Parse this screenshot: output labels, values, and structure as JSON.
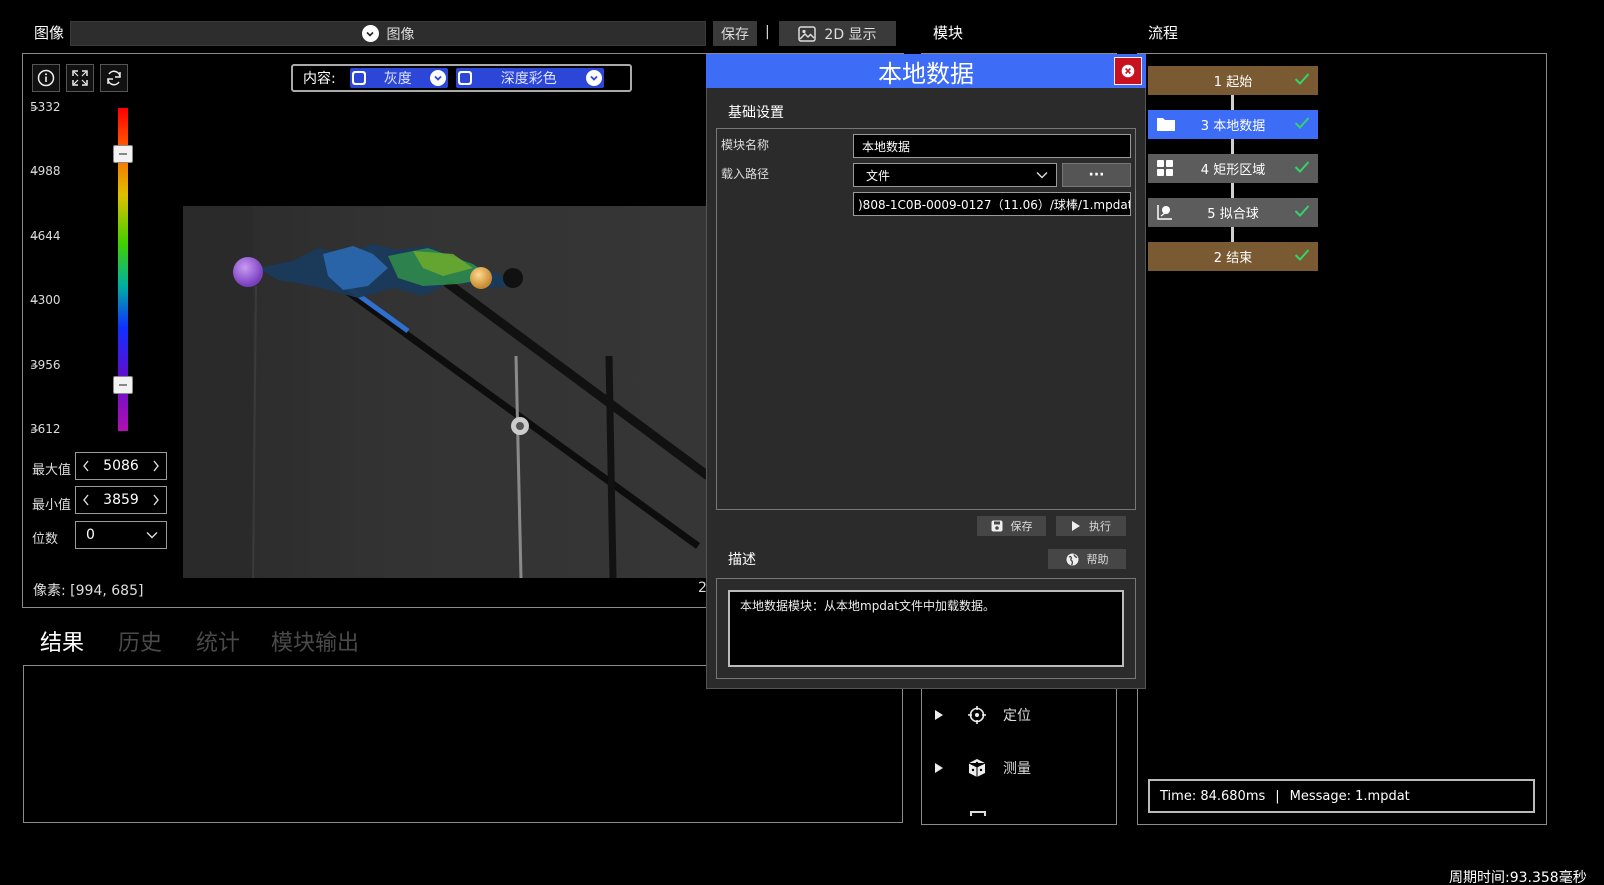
{
  "top": {
    "image_label": "图像",
    "image_combo": "图像",
    "save_label": "保存",
    "separator": "|",
    "display_label": "2D 显示",
    "module_label": "模块",
    "flow_label": "流程"
  },
  "viewer": {
    "content_label": "内容:",
    "gray_label": "灰度",
    "depth_label": "深度彩色",
    "scale_ticks": [
      "5332",
      "4988",
      "4644",
      "4300",
      "3956",
      "3612"
    ],
    "max_label": "最大值",
    "max_value": "5086",
    "min_label": "最小值",
    "min_value": "3859",
    "digits_label": "位数",
    "digits_value": "0",
    "pixel_text": "像素: [994, 685]",
    "clipped_text": "2"
  },
  "results": {
    "tabs": [
      "结果",
      "历史",
      "统计",
      "模块输出"
    ]
  },
  "dialog": {
    "title": "本地数据",
    "section_basic": "基础设置",
    "module_name_label": "模块名称",
    "module_name_value": "本地数据",
    "load_path_label": "载入路径",
    "load_type": "文件",
    "browse_label": "···",
    "path_value": ")808-1C0B-0009-0127（11.06）/球棒/1.mpdat",
    "save_label": "保存",
    "run_label": "执行",
    "desc_label": "描述",
    "help_label": "帮助",
    "desc_text": "本地数据模块：从本地mpdat文件中加载数据。"
  },
  "modules": {
    "items": [
      "定位",
      "测量"
    ]
  },
  "flow": {
    "items": [
      {
        "label": "1 起始",
        "color": "#7a5a32"
      },
      {
        "label": "3 本地数据",
        "color": "#3d6cf7"
      },
      {
        "label": "4 矩形区域",
        "color": "#5c5c5c"
      },
      {
        "label": "5 拟合球",
        "color": "#5c5c5c"
      },
      {
        "label": "2 结束",
        "color": "#7a5a32"
      }
    ],
    "status_time": "Time: 84.680ms",
    "status_sep": "|",
    "status_message": "Message: 1.mpdat"
  },
  "status_bar": {
    "cycle_time": "周期时间:93.358毫秒"
  },
  "colors": {
    "accent_blue": "#3d6cf7",
    "flow_brown": "#7a5a32",
    "check_green": "#35d36b",
    "close_red": "#c8101e"
  }
}
